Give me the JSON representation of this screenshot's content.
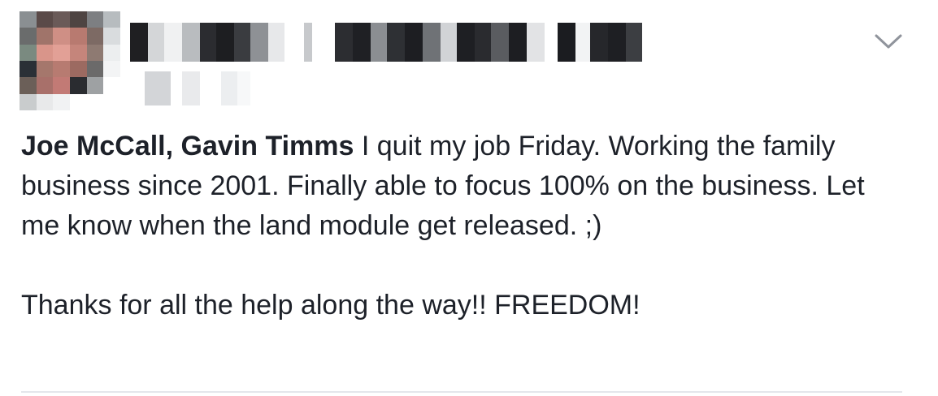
{
  "post": {
    "author_redacted": true,
    "tags": [
      "Joe McCall",
      "Gavin Timms"
    ],
    "tag_separator": ", ",
    "line1_rest": " I quit my job Friday. Working the family business since 2001. Finally able to focus 100% on the business. Let me know when the land module get released. ;)",
    "line2": "Thanks for all the help along the way!!  FREEDOM!"
  },
  "icons": {
    "options": "chevron-down-icon"
  },
  "colors": {
    "text": "#1d2129",
    "divider": "#e4e6eb",
    "background": "#ffffff"
  }
}
